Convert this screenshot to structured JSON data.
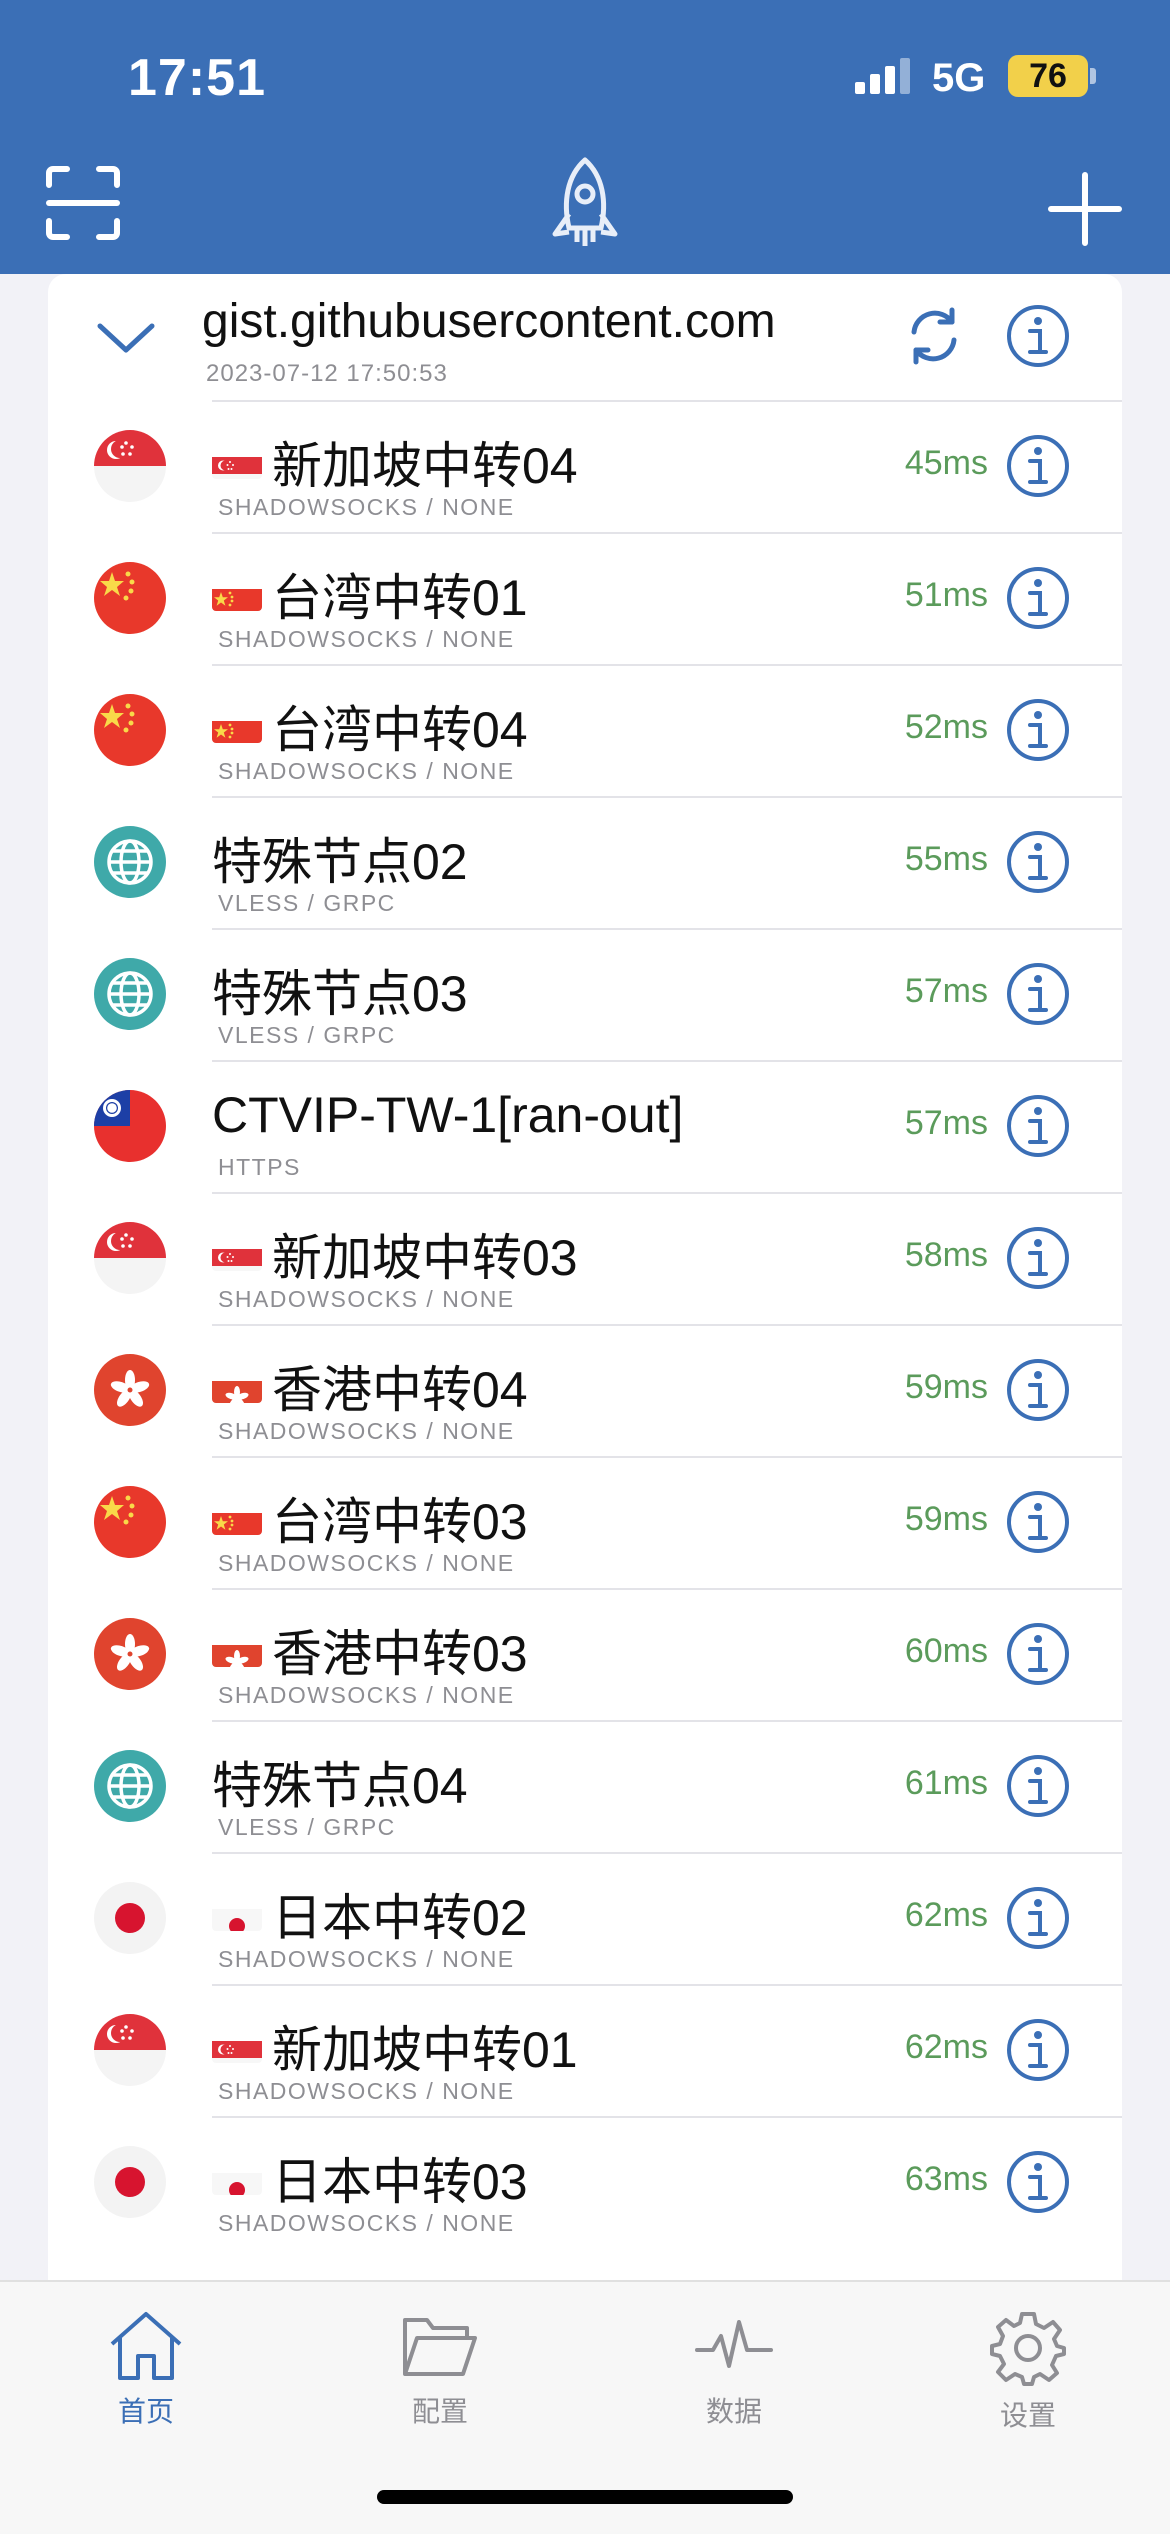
{
  "status": {
    "time": "17:51",
    "network": "5G",
    "battery": "76"
  },
  "header": {
    "scan_icon": "scan-icon",
    "logo_icon": "rocket-icon",
    "add_icon": "plus-icon"
  },
  "group": {
    "title": "gist.githubusercontent.com",
    "date": "2023-07-12 17:50:53"
  },
  "servers": [
    {
      "flag": "sg",
      "name": "新加坡中转04",
      "sub": "SHADOWSOCKS / NONE",
      "latency": "45ms"
    },
    {
      "flag": "cn",
      "name": "台湾中转01",
      "sub": "SHADOWSOCKS / NONE",
      "latency": "51ms"
    },
    {
      "flag": "cn",
      "name": "台湾中转04",
      "sub": "SHADOWSOCKS / NONE",
      "latency": "52ms"
    },
    {
      "flag": "globe",
      "name": "特殊节点02",
      "sub": "VLESS / GRPC",
      "latency": "55ms"
    },
    {
      "flag": "globe",
      "name": "特殊节点03",
      "sub": "VLESS / GRPC",
      "latency": "57ms"
    },
    {
      "flag": "tw",
      "name": "CTVIP-TW-1[ran-out]",
      "sub": "HTTPS",
      "latency": "57ms"
    },
    {
      "flag": "sg",
      "name": "新加坡中转03",
      "sub": "SHADOWSOCKS / NONE",
      "latency": "58ms"
    },
    {
      "flag": "hk",
      "name": "香港中转04",
      "sub": "SHADOWSOCKS / NONE",
      "latency": "59ms"
    },
    {
      "flag": "cn",
      "name": "台湾中转03",
      "sub": "SHADOWSOCKS / NONE",
      "latency": "59ms"
    },
    {
      "flag": "hk",
      "name": "香港中转03",
      "sub": "SHADOWSOCKS / NONE",
      "latency": "60ms"
    },
    {
      "flag": "globe",
      "name": "特殊节点04",
      "sub": "VLESS / GRPC",
      "latency": "61ms"
    },
    {
      "flag": "jp",
      "name": "日本中转02",
      "sub": "SHADOWSOCKS / NONE",
      "latency": "62ms"
    },
    {
      "flag": "sg",
      "name": "新加坡中转01",
      "sub": "SHADOWSOCKS / NONE",
      "latency": "62ms"
    },
    {
      "flag": "jp",
      "name": "日本中转03",
      "sub": "SHADOWSOCKS / NONE",
      "latency": "63ms"
    }
  ],
  "tabs": [
    {
      "label": "首页",
      "icon": "home-icon",
      "active": true
    },
    {
      "label": "配置",
      "icon": "folder-icon",
      "active": false
    },
    {
      "label": "数据",
      "icon": "pulse-icon",
      "active": false
    },
    {
      "label": "设置",
      "icon": "gear-icon",
      "active": false
    }
  ],
  "colors": {
    "accent": "#3b6fb6",
    "latency": "#5b9b5b",
    "inactive_tab": "#8e8e93"
  }
}
